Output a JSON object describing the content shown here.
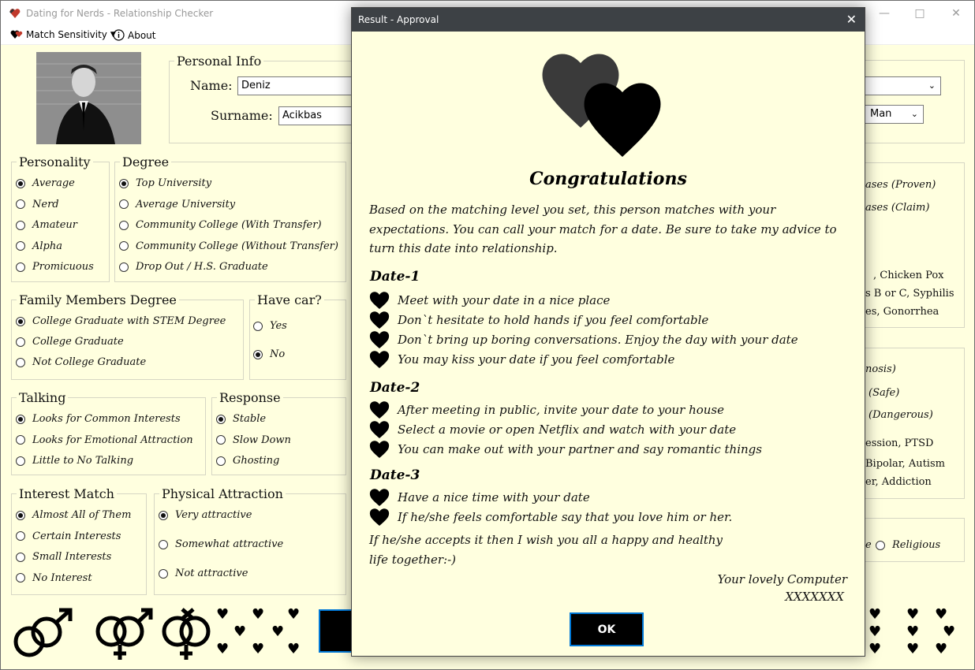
{
  "window": {
    "title": "Dating for Nerds - Relationship Checker"
  },
  "menu": {
    "match_sensitivity": "Match Sensitivity",
    "about": "About"
  },
  "personal_info": {
    "legend": "Personal Info",
    "name_label": "Name:",
    "name_value": "Deniz",
    "surname_label": "Surname:",
    "surname_value": "Acikbas",
    "gender_value": "Man"
  },
  "personality": {
    "legend": "Personality",
    "options": [
      "Average",
      "Nerd",
      "Amateur",
      "Alpha",
      "Promicuous"
    ],
    "selected": 0
  },
  "degree": {
    "legend": "Degree",
    "options": [
      "Top University",
      "Average University",
      "Community College (With Transfer)",
      "Community College (Without Transfer)",
      "Drop Out / H.S. Graduate"
    ],
    "selected": 0
  },
  "family": {
    "legend": "Family Members Degree",
    "options": [
      "College Graduate with STEM Degree",
      "College Graduate",
      "Not College Graduate"
    ],
    "selected": 0
  },
  "car": {
    "legend": "Have car?",
    "options": [
      "Yes",
      "No"
    ],
    "selected": 1
  },
  "talking": {
    "legend": "Talking",
    "options": [
      "Looks for Common Interests",
      "Looks for Emotional Attraction",
      "Little to No Talking"
    ],
    "selected": 0
  },
  "response": {
    "legend": "Response",
    "options": [
      "Stable",
      "Slow Down",
      "Ghosting"
    ],
    "selected": 0
  },
  "interest": {
    "legend": "Interest Match",
    "options": [
      "Almost All of Them",
      "Certain Interests",
      "Small Interests",
      "No Interest"
    ],
    "selected": 0
  },
  "physical": {
    "legend": "Physical Attraction",
    "options": [
      "Very attractive",
      "Somewhat attractive",
      "Not attractive"
    ],
    "selected": 0
  },
  "right_partial": {
    "disease_1": "ases (Proven)",
    "disease_2": "ases (Claim)",
    "disease_3": ", Chicken Pox",
    "disease_4": "s B or C, Syphilis",
    "disease_5": "es, Gonorrhea",
    "mental_1": "nosis)",
    "mental_2": "(Safe)",
    "mental_3": "(Dangerous)",
    "mental_4": "ession, PTSD",
    "mental_5": "Bipolar, Autism",
    "mental_6": "er, Addiction",
    "religion_1": "e",
    "religion_2": "Religious"
  },
  "dialog": {
    "title": "Result - Approval",
    "heading": "Congratulations",
    "intro": "Based on the matching level you set, this person matches with your expectations. You can call your match for a date. Be sure to take my advice to turn this date into relationship.",
    "dates": [
      {
        "title": "Date-1",
        "items": [
          "Meet with your date in a nice place",
          "Don`t hesitate to hold hands if you feel comfortable",
          "Don`t bring up boring conversations. Enjoy the day with your date",
          "You may kiss your date if you feel comfortable"
        ]
      },
      {
        "title": "Date-2",
        "items": [
          "After meeting in public, invite your date to your house",
          "Select a movie or open Netflix and watch with your date",
          "You can make out with your partner and say romantic things"
        ]
      },
      {
        "title": "Date-3",
        "items": [
          "Have a nice time with your date",
          "If he/she feels comfortable say that you love him or her."
        ]
      }
    ],
    "closing": "If he/she accepts it then I wish you all a happy and healthy life together:-)",
    "signature": "Your lovely Computer",
    "signature_name": "XXXXXXX",
    "ok_label": "OK"
  },
  "colors": {
    "dialog_titlebar": "#3d4145",
    "background": "#ffffdf",
    "focus": "#0078d7"
  }
}
